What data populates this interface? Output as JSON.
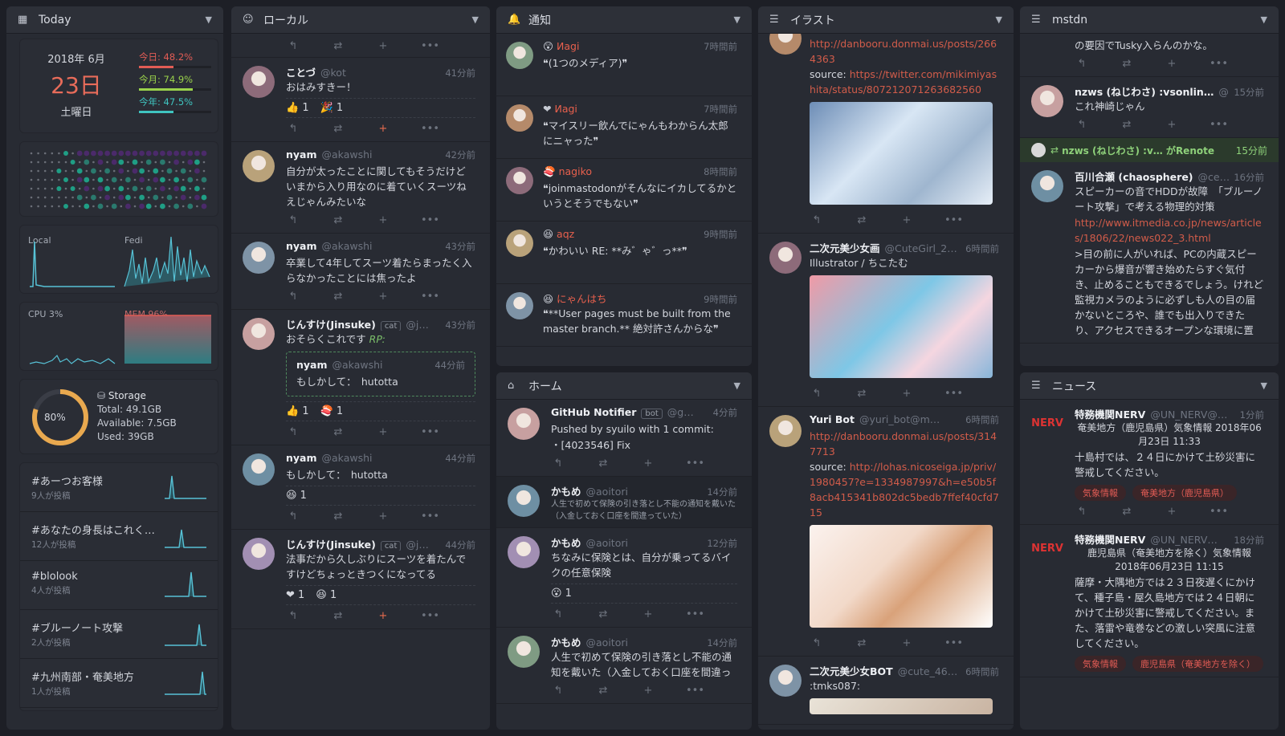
{
  "today": {
    "title": "Today",
    "year_month": "2018年 6月",
    "day": "23日",
    "weekday": "土曜日",
    "stats": [
      {
        "label": "今日: 48.2%",
        "pct": 48.2,
        "color": "#e25c55"
      },
      {
        "label": "今月: 74.9%",
        "pct": 74.9,
        "color": "#9ad24b"
      },
      {
        "label": "今年: 47.5%",
        "pct": 47.5,
        "color": "#3fc4c0"
      }
    ],
    "graph_labels": {
      "local": "Local",
      "fedi": "Fedi",
      "cpu": "CPU 3%",
      "mem": "MEM 96%"
    },
    "storage": {
      "pct_label": "80%",
      "pct": 80,
      "title": "Storage",
      "total": "Total: 49.1GB",
      "available": "Available: 7.5GB",
      "used": "Used: 39GB"
    },
    "tags": [
      {
        "name": "#あーつお客様",
        "count": "9人が投稿"
      },
      {
        "name": "#あなたの身長はこれく…",
        "count": "12人が投稿"
      },
      {
        "name": "#blolook",
        "count": "4人が投稿"
      },
      {
        "name": "#ブルーノート攻撃",
        "count": "2人が投稿"
      },
      {
        "name": "#九州南部・奄美地方",
        "count": "1人が投稿"
      }
    ]
  },
  "local": {
    "title": "ローカル",
    "notes": [
      {
        "name": "ことづ",
        "user": "@kot",
        "time": "41分前",
        "text": "おはみすきー！",
        "reacts": [
          "👍 1",
          "🎉 1"
        ]
      },
      {
        "name": "nyam",
        "user": "@akawshi",
        "time": "42分前",
        "text": "自分が太ったことに関してもそうだけどいまから入り用なのに着ていくスーツねえじゃんみたいな"
      },
      {
        "name": "nyam",
        "user": "@akawshi",
        "time": "43分前",
        "text": "卒業して4年してスーツ着たらまったく入らなかったことには焦ったよ"
      },
      {
        "name": "じんすけ(Jinsuke)",
        "user": "@j…",
        "time": "43分前",
        "badge": "cat",
        "text": "おそらくこれです",
        "rp": "RP:",
        "quote": {
          "name": "nyam",
          "user": "@akawshi",
          "time": "44分前",
          "text": "もしかして：　hutotta"
        },
        "reacts": [
          "👍 1",
          "🍣 1"
        ]
      },
      {
        "name": "nyam",
        "user": "@akawshi",
        "time": "44分前",
        "text": "もしかして：　hutotta",
        "reacts": [
          "😆 1"
        ]
      },
      {
        "name": "じんすけ(Jinsuke)",
        "user": "@j…",
        "time": "44分前",
        "badge": "cat",
        "text": "法事だから久しぶりにスーツを着たんですけどちょっときつくになってる",
        "reacts": [
          "❤ 1",
          "😆 1"
        ]
      }
    ]
  },
  "notif": {
    "title": "通知",
    "items": [
      {
        "name": "Иagi",
        "time": "7時間前",
        "text": "❝(1つのメディア)❞"
      },
      {
        "name": "Иagi",
        "time": "7時間前",
        "text": "❝マイスリー飲んでにゃんもわからん太郎にニャった❞"
      },
      {
        "name": "nagiko",
        "time": "8時間前",
        "text": "❝joinmastodonがそんなにイカしてるかというとそうでもない❞"
      },
      {
        "name": "aqz",
        "time": "9時間前",
        "text": "❝かわいい RE: **み゛ゃ゛っ**❞"
      },
      {
        "name": "にゃんはち",
        "time": "9時間前",
        "text": "❝**User pages must be built from the master branch.** 絶対許さんからな❞"
      }
    ]
  },
  "home": {
    "title": "ホーム",
    "notes": [
      {
        "name": "GitHub Notifier",
        "badge": "bot",
        "user": "@g…",
        "time": "4分前",
        "text": "Pushed by syuilo with 1 commit:",
        "text2": "・[4023546] Fix"
      },
      {
        "name": "かもめ",
        "user": "@aoitori",
        "time": "14分前",
        "text": "人生で初めて保険の引き落とし不能の通知を戴いた（入金しておく口座を間違っていた）"
      },
      {
        "name": "かもめ",
        "user": "@aoitori",
        "time": "12分前",
        "text": "ちなみに保険とは、自分が乗ってるバイクの任意保険",
        "reacts": [
          "😮 1"
        ]
      },
      {
        "name": "かもめ",
        "user": "@aoitori",
        "time": "14分前",
        "text": "人生で初めて保険の引き落とし不能の通知を戴いた（入金しておく口座を間違っ"
      }
    ]
  },
  "illust": {
    "title": "イラスト",
    "notes": [
      {
        "link1": "http://danbooru.donmai.us/posts/2664363",
        "src_label": "source:",
        "link2": "https://twitter.com/mikimiyashita/status/807212071263682560"
      },
      {
        "name": "二次元美少女画",
        "user": "@CuteGirl_2…",
        "time": "6時間前",
        "text": "Illustrator / ちこたむ"
      },
      {
        "name": "Yuri Bot",
        "user": "@yuri_bot@m…",
        "time": "6時間前",
        "link1": "http://danbooru.donmai.us/posts/3147713",
        "src_label": "source:",
        "link2": "http://lohas.nicoseiga.jp/priv/1980457?e=1334987997&h=e50b5f8acb415341b802dc5bedb7ffef40cfd715"
      },
      {
        "name": "二次元美少女BOT",
        "user": "@cute_46…",
        "time": "6時間前",
        "text": ":tmks087:"
      }
    ]
  },
  "mstdn": {
    "title": "mstdn",
    "notes": [
      {
        "text": "の要因でTusky入らんのかな。"
      },
      {
        "name": "nzws (ねじわさ) :vsonlin…",
        "user": "@",
        "time": "15分前",
        "text": "これ神崎じゃん"
      },
      {
        "renote": "nzws (ねじわさ) :v… がRenote",
        "time": "15分前"
      },
      {
        "name": "百川合瀬 (chaosphere)",
        "user": "@ce…",
        "time": "16分前",
        "text": "スピーカーの音でHDDが故障　「ブルーノート攻撃」で考える物理的対策",
        "link": "http://www.itmedia.co.jp/news/articles/1806/22/news022_3.html",
        "text2": ">目の前に人がいれば、PCの内蔵スピーカーから爆音が響き始めたらすぐ気付き、止めることもできるでしょう。けれど監視カメラのように必ずしも人の目の届かないところや、誰でも出入りできたり、アクセスできるオープンな環境に置"
      }
    ]
  },
  "news": {
    "title": "ニュース",
    "notes": [
      {
        "name": "特務機関NERV",
        "user": "@UN_NERV@…",
        "time": "1分前",
        "center": "奄美地方（鹿児島県）気象情報 2018年06月23日 11:33",
        "text": "十島村では、２４日にかけて土砂災害に警戒してください。",
        "tags": [
          "気象情報",
          "奄美地方（鹿児島県）"
        ]
      },
      {
        "name": "特務機関NERV",
        "user": "@UN_NERV…",
        "time": "18分前",
        "center": "鹿児島県（奄美地方を除く）気象情報 2018年06月23日 11:15",
        "text": "薩摩・大隅地方では２３日夜遅くにかけて、種子島・屋久島地方では２４日朝にかけて土砂災害に警戒してください。また、落雷や竜巻などの激しい突風に注意してください。",
        "tags": [
          "気象情報",
          "鹿児島県（奄美地方を除く）"
        ]
      }
    ]
  }
}
